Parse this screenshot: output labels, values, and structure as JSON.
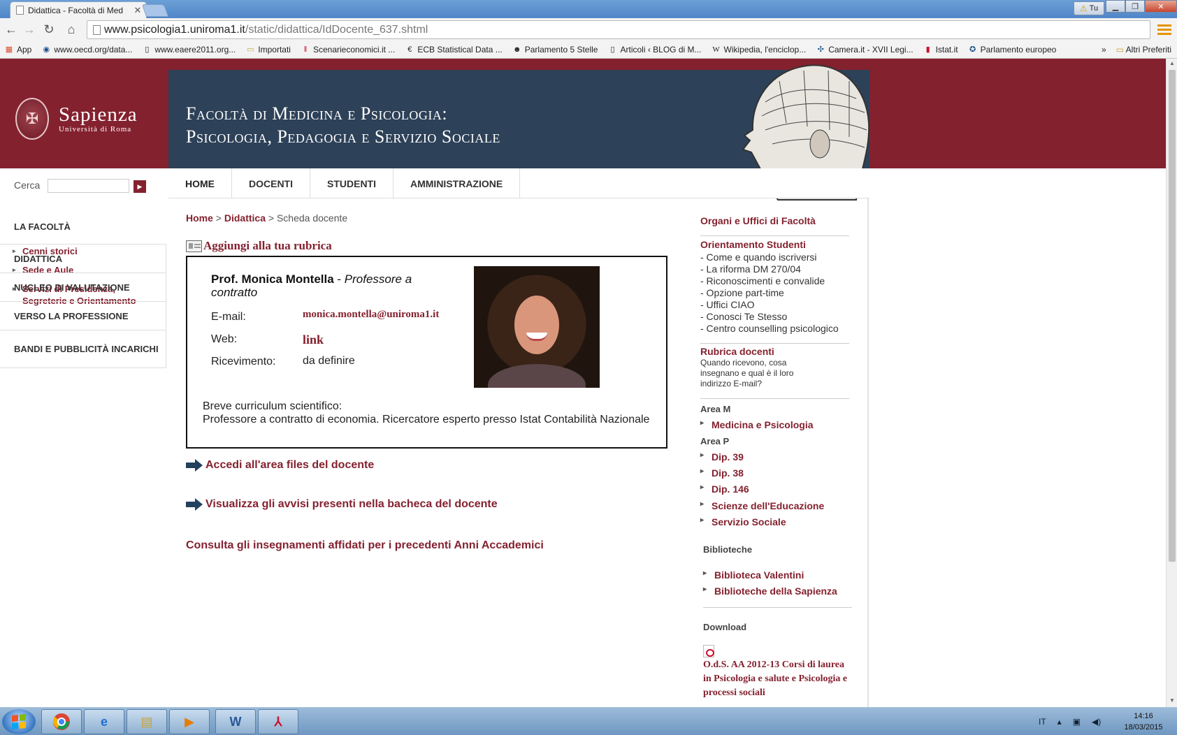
{
  "browser": {
    "tab_title": "Didattica - Facoltà di Med",
    "url_host": "www.psicologia1.uniroma1.it",
    "url_path": "/static/didattica/IdDocente_637.shtml",
    "user_label": "Tu",
    "bookmarks": [
      {
        "label": "App",
        "icon": "apps-grid-icon"
      },
      {
        "label": "www.oecd.org/data...",
        "icon": "oecd-icon"
      },
      {
        "label": "www.eaere2011.org...",
        "icon": "page-icon"
      },
      {
        "label": "Importati",
        "icon": "folder-icon"
      },
      {
        "label": "Scenarieconomici.it ...",
        "icon": "scenari-icon"
      },
      {
        "label": "ECB Statistical Data ...",
        "icon": "ecb-icon"
      },
      {
        "label": "Parlamento 5 Stelle",
        "icon": "m5s-icon"
      },
      {
        "label": "Articoli ‹ BLOG di M...",
        "icon": "page-icon"
      },
      {
        "label": "Wikipedia, l'enciclop...",
        "icon": "wikipedia-icon"
      },
      {
        "label": "Camera.it - XVII Legi...",
        "icon": "camera-icon"
      },
      {
        "label": "Istat.it",
        "icon": "istat-icon"
      },
      {
        "label": "Parlamento europeo",
        "icon": "eu-icon"
      }
    ],
    "overflow": "»",
    "other_bookmarks": "Altri Preferiti"
  },
  "site": {
    "logo_name": "Sapienza",
    "logo_sub": "Università di Roma",
    "faculty_line1": "Facoltà di Medicina e Psicologia:",
    "faculty_line2": "Psicologia, Pedagogia e Servizio Sociale",
    "search_label": "Cerca",
    "nav": [
      "HOME",
      "DOCENTI",
      "STUDENTI",
      "AMMINISTRAZIONE"
    ]
  },
  "sidebar": {
    "section": "LA FACOLTÀ",
    "links": [
      "Cenni storici",
      "Sede e Aule",
      "Servizi di Presidenza, Segreterie e Orientamento"
    ],
    "menu": [
      "DIDATTICA",
      "NUCLEO DI VALUTAZIONE",
      "VERSO LA PROFESSIONE",
      "BANDI E PUBBLICITÀ INCARICHI"
    ]
  },
  "main": {
    "breadcrumb": {
      "home": "Home",
      "sep": ">",
      "didattica": "Didattica",
      "current": "Scheda docente"
    },
    "add_contact": "Aggiungi alla tua rubrica",
    "teacher": {
      "name": "Prof. Monica Montella",
      "role": "Professore a contratto",
      "email_label": "E-mail:",
      "email": "monica.montella@uniroma1.it",
      "web_label": "Web:",
      "web": "link",
      "ric_label": "Ricevimento:",
      "ric": "da definire",
      "cv_title": "Breve curriculum scientifico:",
      "cv_text": "Professore a contratto di economia. Ricercatore esperto presso Istat Contabilità Nazionale"
    },
    "files_link": "Accedi all'area files del docente",
    "notices_link": "Visualizza gli avvisi presenti nella bacheca del docente",
    "previous_link": "Consulta gli insegnamenti affidati per i precedenti Anni Accademici"
  },
  "right": {
    "organi": "Organi e Uffici di Facoltà",
    "orientamento": "Orientamento Studenti",
    "orient_items": [
      "- Come e quando iscriversi",
      "- La riforma DM 270/04",
      "- Riconoscimenti e convalide",
      "- Opzione part-time",
      "- Uffici CIAO",
      "- Conosci Te Stesso",
      "- Centro counselling psicologico"
    ],
    "rubrica_title": "Rubrica docenti",
    "rubrica_text": "Quando ricevono, cosa insegnano e qual è il loro indirizzo E-mail?",
    "area_m": "Area M",
    "area_m_items": [
      "Medicina e Psicologia"
    ],
    "area_p": "Area P",
    "area_p_items": [
      "Dip. 39",
      "Dip. 38",
      "Dip. 146",
      "Scienze dell'Educazione",
      "Servizio Sociale"
    ],
    "biblioteche": "Biblioteche",
    "biblio_items": [
      "Biblioteca Valentini",
      "Biblioteche della Sapienza"
    ],
    "download": "Download",
    "download_item": "O.d.S. AA 2012-13 Corsi di laurea in Psicologia e salute e Psicologia e processi sociali"
  },
  "taskbar": {
    "lang": "IT",
    "time": "14:16",
    "date": "18/03/2015"
  },
  "colors": {
    "brand": "#84212f",
    "header_blue": "#2d4158"
  }
}
